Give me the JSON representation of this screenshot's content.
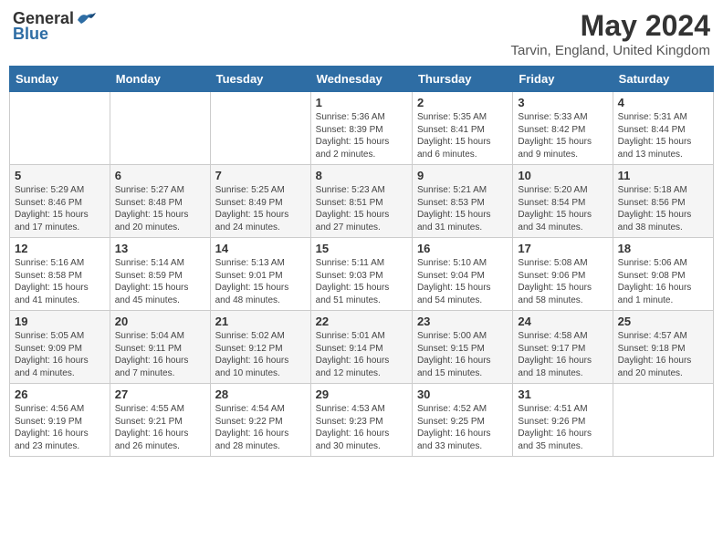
{
  "logo": {
    "general": "General",
    "blue": "Blue"
  },
  "title": "May 2024",
  "location": "Tarvin, England, United Kingdom",
  "days_of_week": [
    "Sunday",
    "Monday",
    "Tuesday",
    "Wednesday",
    "Thursday",
    "Friday",
    "Saturday"
  ],
  "weeks": [
    [
      {
        "day": "",
        "info": ""
      },
      {
        "day": "",
        "info": ""
      },
      {
        "day": "",
        "info": ""
      },
      {
        "day": "1",
        "info": "Sunrise: 5:36 AM\nSunset: 8:39 PM\nDaylight: 15 hours\nand 2 minutes."
      },
      {
        "day": "2",
        "info": "Sunrise: 5:35 AM\nSunset: 8:41 PM\nDaylight: 15 hours\nand 6 minutes."
      },
      {
        "day": "3",
        "info": "Sunrise: 5:33 AM\nSunset: 8:42 PM\nDaylight: 15 hours\nand 9 minutes."
      },
      {
        "day": "4",
        "info": "Sunrise: 5:31 AM\nSunset: 8:44 PM\nDaylight: 15 hours\nand 13 minutes."
      }
    ],
    [
      {
        "day": "5",
        "info": "Sunrise: 5:29 AM\nSunset: 8:46 PM\nDaylight: 15 hours\nand 17 minutes."
      },
      {
        "day": "6",
        "info": "Sunrise: 5:27 AM\nSunset: 8:48 PM\nDaylight: 15 hours\nand 20 minutes."
      },
      {
        "day": "7",
        "info": "Sunrise: 5:25 AM\nSunset: 8:49 PM\nDaylight: 15 hours\nand 24 minutes."
      },
      {
        "day": "8",
        "info": "Sunrise: 5:23 AM\nSunset: 8:51 PM\nDaylight: 15 hours\nand 27 minutes."
      },
      {
        "day": "9",
        "info": "Sunrise: 5:21 AM\nSunset: 8:53 PM\nDaylight: 15 hours\nand 31 minutes."
      },
      {
        "day": "10",
        "info": "Sunrise: 5:20 AM\nSunset: 8:54 PM\nDaylight: 15 hours\nand 34 minutes."
      },
      {
        "day": "11",
        "info": "Sunrise: 5:18 AM\nSunset: 8:56 PM\nDaylight: 15 hours\nand 38 minutes."
      }
    ],
    [
      {
        "day": "12",
        "info": "Sunrise: 5:16 AM\nSunset: 8:58 PM\nDaylight: 15 hours\nand 41 minutes."
      },
      {
        "day": "13",
        "info": "Sunrise: 5:14 AM\nSunset: 8:59 PM\nDaylight: 15 hours\nand 45 minutes."
      },
      {
        "day": "14",
        "info": "Sunrise: 5:13 AM\nSunset: 9:01 PM\nDaylight: 15 hours\nand 48 minutes."
      },
      {
        "day": "15",
        "info": "Sunrise: 5:11 AM\nSunset: 9:03 PM\nDaylight: 15 hours\nand 51 minutes."
      },
      {
        "day": "16",
        "info": "Sunrise: 5:10 AM\nSunset: 9:04 PM\nDaylight: 15 hours\nand 54 minutes."
      },
      {
        "day": "17",
        "info": "Sunrise: 5:08 AM\nSunset: 9:06 PM\nDaylight: 15 hours\nand 58 minutes."
      },
      {
        "day": "18",
        "info": "Sunrise: 5:06 AM\nSunset: 9:08 PM\nDaylight: 16 hours\nand 1 minute."
      }
    ],
    [
      {
        "day": "19",
        "info": "Sunrise: 5:05 AM\nSunset: 9:09 PM\nDaylight: 16 hours\nand 4 minutes."
      },
      {
        "day": "20",
        "info": "Sunrise: 5:04 AM\nSunset: 9:11 PM\nDaylight: 16 hours\nand 7 minutes."
      },
      {
        "day": "21",
        "info": "Sunrise: 5:02 AM\nSunset: 9:12 PM\nDaylight: 16 hours\nand 10 minutes."
      },
      {
        "day": "22",
        "info": "Sunrise: 5:01 AM\nSunset: 9:14 PM\nDaylight: 16 hours\nand 12 minutes."
      },
      {
        "day": "23",
        "info": "Sunrise: 5:00 AM\nSunset: 9:15 PM\nDaylight: 16 hours\nand 15 minutes."
      },
      {
        "day": "24",
        "info": "Sunrise: 4:58 AM\nSunset: 9:17 PM\nDaylight: 16 hours\nand 18 minutes."
      },
      {
        "day": "25",
        "info": "Sunrise: 4:57 AM\nSunset: 9:18 PM\nDaylight: 16 hours\nand 20 minutes."
      }
    ],
    [
      {
        "day": "26",
        "info": "Sunrise: 4:56 AM\nSunset: 9:19 PM\nDaylight: 16 hours\nand 23 minutes."
      },
      {
        "day": "27",
        "info": "Sunrise: 4:55 AM\nSunset: 9:21 PM\nDaylight: 16 hours\nand 26 minutes."
      },
      {
        "day": "28",
        "info": "Sunrise: 4:54 AM\nSunset: 9:22 PM\nDaylight: 16 hours\nand 28 minutes."
      },
      {
        "day": "29",
        "info": "Sunrise: 4:53 AM\nSunset: 9:23 PM\nDaylight: 16 hours\nand 30 minutes."
      },
      {
        "day": "30",
        "info": "Sunrise: 4:52 AM\nSunset: 9:25 PM\nDaylight: 16 hours\nand 33 minutes."
      },
      {
        "day": "31",
        "info": "Sunrise: 4:51 AM\nSunset: 9:26 PM\nDaylight: 16 hours\nand 35 minutes."
      },
      {
        "day": "",
        "info": ""
      }
    ]
  ]
}
